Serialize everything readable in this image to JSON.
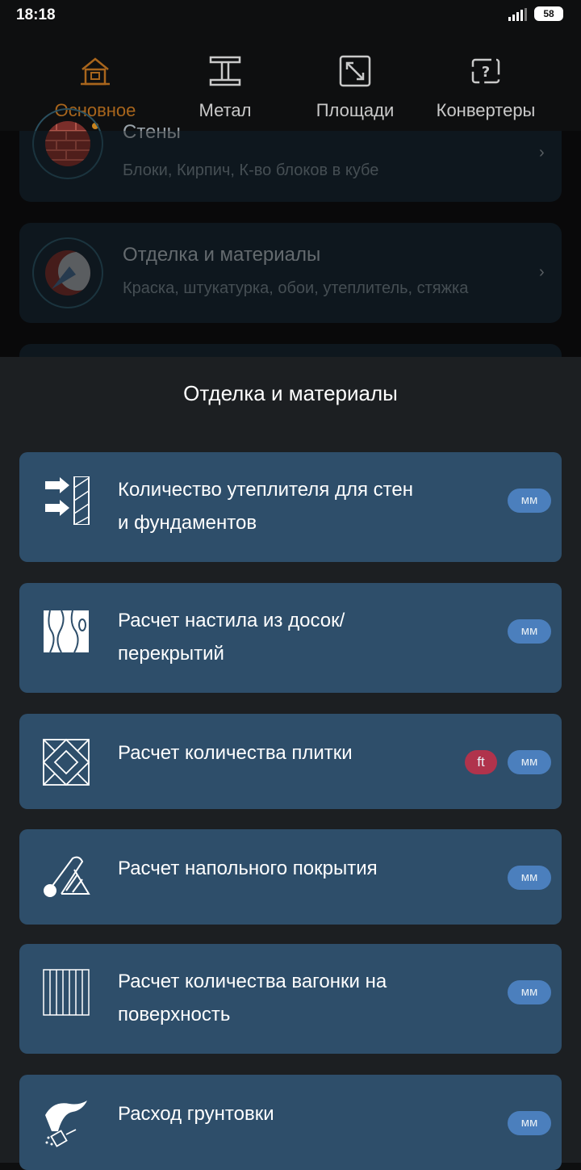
{
  "status": {
    "time": "18:18",
    "battery": "58"
  },
  "tabs": [
    {
      "label": "Основное",
      "icon": "house-brick-icon",
      "active": true
    },
    {
      "label": "Метал",
      "icon": "i-beam-icon",
      "active": false
    },
    {
      "label": "Площади",
      "icon": "expand-arrows-icon",
      "active": false
    },
    {
      "label": "Конвертеры",
      "icon": "convert-question-icon",
      "active": false
    }
  ],
  "background_cards": [
    {
      "title": "Стены",
      "subtitle": "Блоки, Кирпич, К-во блоков в кубе",
      "icon": "brick-wall-icon"
    },
    {
      "title": "Отделка и материалы",
      "subtitle": "Краска, штукатурка, обои, утеплитель, стяжка",
      "icon": "trowel-icon"
    }
  ],
  "sheet": {
    "title": "Отделка и материалы",
    "items": [
      {
        "line1": "Количество утеплителя для стен",
        "line2": "и фундаментов",
        "icon": "insulation-arrows-icon",
        "badges": [
          "мм"
        ]
      },
      {
        "line1": "Расчет настила из досок/",
        "line2": "перекрытий",
        "icon": "wood-grain-icon",
        "badges": [
          "мм"
        ]
      },
      {
        "line1": "Расчет количества плитки",
        "line2": "",
        "icon": "tile-pattern-icon",
        "badges": [
          "ft",
          "мм"
        ]
      },
      {
        "line1": "Расчет напольного покрытия",
        "line2": "",
        "icon": "floor-roll-icon",
        "badges": [
          "мм"
        ]
      },
      {
        "line1": "Расчет количества вагонки на",
        "line2": "поверхность",
        "icon": "wall-panel-icon",
        "badges": [
          "мм"
        ]
      },
      {
        "line1": "Расход грунтовки",
        "line2": "",
        "icon": "primer-spray-icon",
        "badges": [
          "мм"
        ]
      }
    ]
  },
  "colors": {
    "accent": "#c8841f",
    "card": "#2e4e6a",
    "badge_mm": "#4b7fbd",
    "badge_ft": "#b0334c",
    "sheet_bg": "#1c1f22"
  }
}
